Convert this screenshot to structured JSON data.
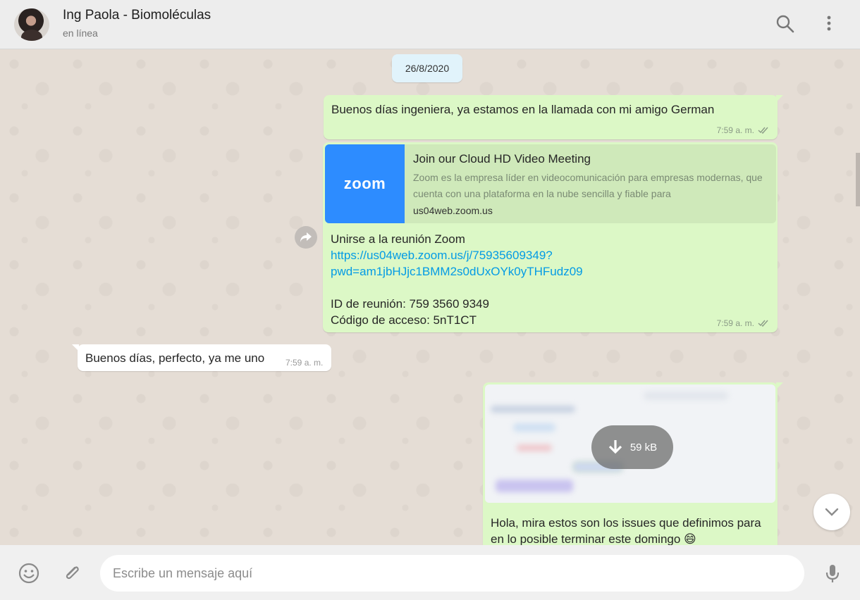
{
  "header": {
    "contact_name": "Ing Paola - Biomoléculas",
    "status": "en línea",
    "icons": [
      "search-icon",
      "menu-icon"
    ]
  },
  "chat": {
    "date_chip": "26/8/2020",
    "messages": [
      {
        "direction": "outgoing",
        "text": "Buenos días ingeniera, ya estamos en la llamada con mi amigo German",
        "time": "7:59 a. m.",
        "status": "read"
      },
      {
        "direction": "outgoing",
        "link_preview": {
          "logo_text": "zoom",
          "title": "Join our Cloud HD Video Meeting",
          "description": "Zoom es la empresa líder en videocomunicación para empresas modernas, que cuenta con una plataforma en la nube sencilla y fiable para",
          "host": "us04web.zoom.us"
        },
        "line1": "Unirse a la reunión Zoom",
        "link_part1": "https://us04web.zoom.us/j/75935609349?",
        "link_part2": "pwd=am1jbHJjc1BMM2s0dUxOYk0yTHFudz09",
        "meeting_id": "ID de reunión: 759 3560 9349",
        "access_code": "Código de acceso: 5nT1CT",
        "time": "7:59 a. m.",
        "status": "read"
      },
      {
        "direction": "incoming",
        "text": "Buenos días, perfecto, ya me uno",
        "time": "7:59 a. m."
      },
      {
        "direction": "outgoing",
        "image_download_size": "59 kB",
        "text": "Hola, mira estos son los issues que definimos para en lo posible terminar este domingo 😄"
      }
    ]
  },
  "footer": {
    "placeholder": "Escribe un mensaje aquí",
    "icons": [
      "emoji-icon",
      "attach-icon",
      "mic-icon"
    ]
  },
  "colors": {
    "outgoing_bubble": "#dcf8c6",
    "incoming_bubble": "#ffffff",
    "link": "#039be5",
    "zoom_blue": "#2d8cff",
    "read_ticks": "#4fc3f7"
  }
}
